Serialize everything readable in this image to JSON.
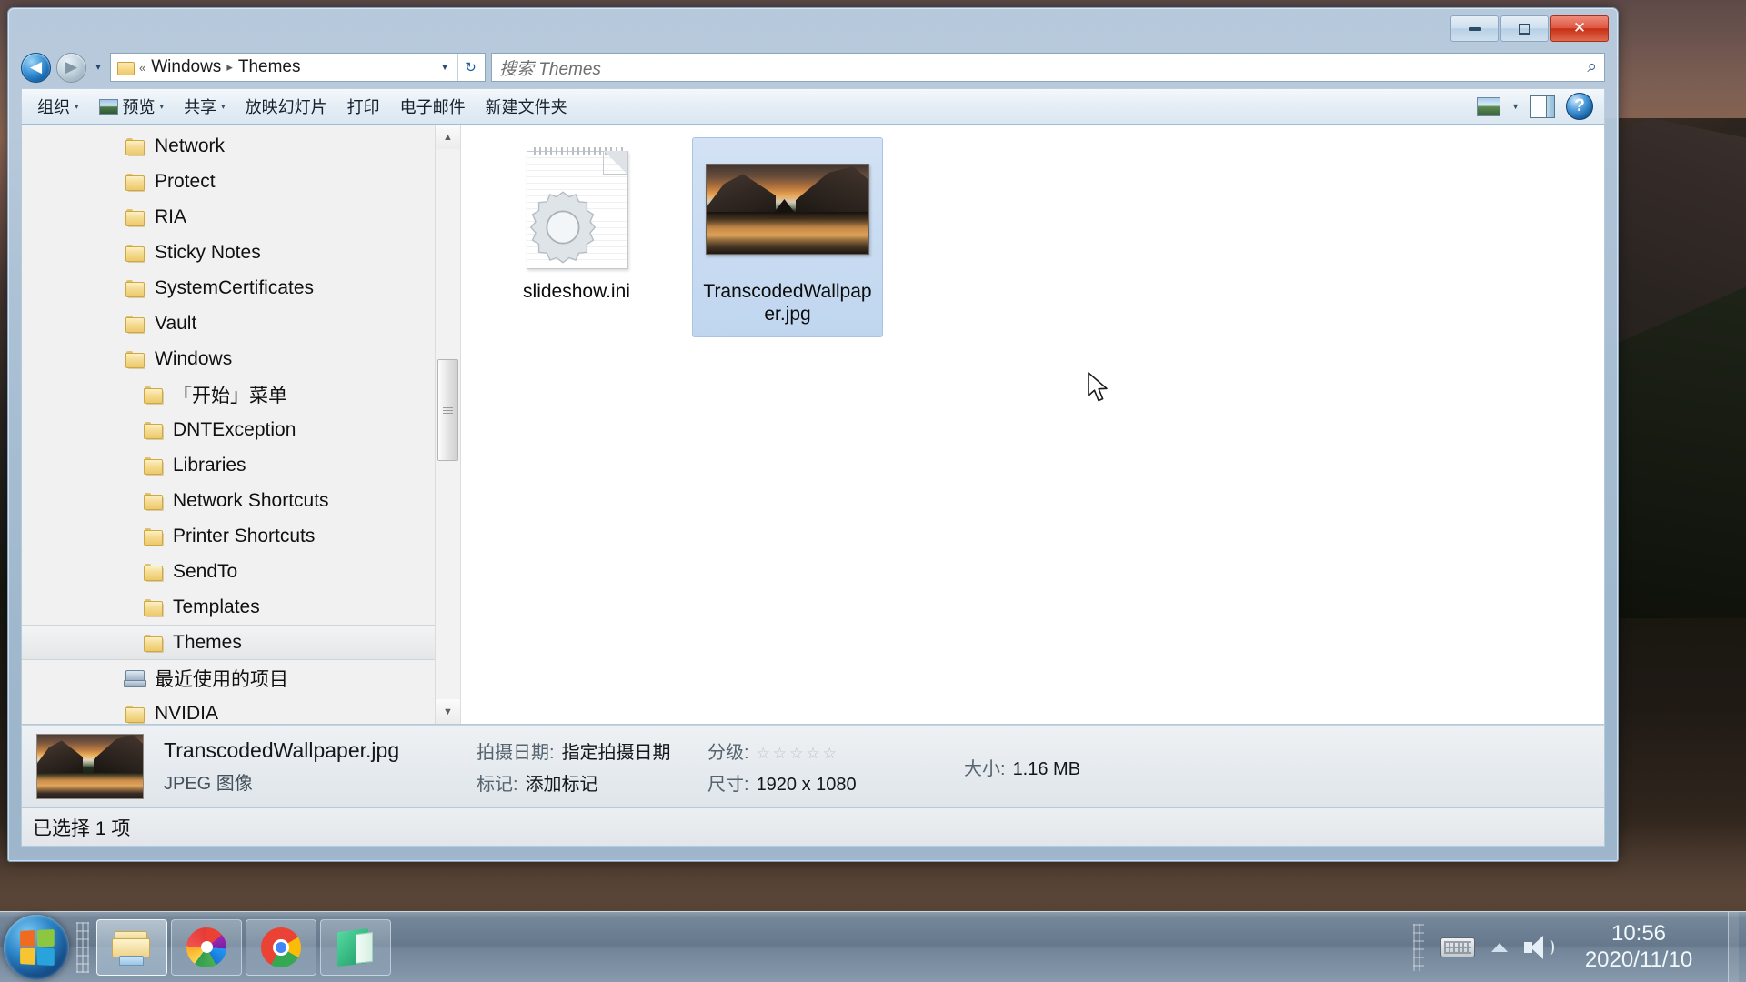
{
  "window": {
    "controls": {
      "minimize_label": "最小化",
      "maximize_label": "最大化",
      "close_label": "关闭",
      "close_glyph": "✕"
    }
  },
  "address_bar": {
    "back_label": "后退",
    "forward_label": "前进",
    "recent_dropdown_label": "最近的位置",
    "breadcrumb_prefix": "«",
    "breadcrumbs": [
      "Windows",
      "Themes"
    ],
    "separator": "▸",
    "dropdown_glyph": "▼",
    "refresh_glyph": "↻",
    "folder_icon": "folder-icon"
  },
  "search": {
    "placeholder": "搜索 Themes",
    "icon": "search-icon"
  },
  "toolbar": {
    "items": [
      {
        "label": "组织",
        "has_caret": true,
        "has_thumb": false
      },
      {
        "label": "预览",
        "has_caret": true,
        "has_thumb": true
      },
      {
        "label": "共享",
        "has_caret": true,
        "has_thumb": false
      },
      {
        "label": "放映幻灯片",
        "has_caret": false,
        "has_thumb": false
      },
      {
        "label": "打印",
        "has_caret": false,
        "has_thumb": false
      },
      {
        "label": "电子邮件",
        "has_caret": false,
        "has_thumb": false
      },
      {
        "label": "新建文件夹",
        "has_caret": false,
        "has_thumb": false
      }
    ],
    "view_button_label": "更改您的视图",
    "view_caret": "▼",
    "preview_pane_label": "显示预览窗格",
    "help_label": "获取帮助",
    "help_glyph": "?"
  },
  "tree": {
    "items": [
      {
        "label": "Network",
        "icon": "folder-icon",
        "indent": false,
        "selected": false
      },
      {
        "label": "Protect",
        "icon": "folder-icon",
        "indent": false,
        "selected": false
      },
      {
        "label": "RIA",
        "icon": "folder-icon",
        "indent": false,
        "selected": false
      },
      {
        "label": "Sticky Notes",
        "icon": "folder-icon",
        "indent": false,
        "selected": false
      },
      {
        "label": "SystemCertificates",
        "icon": "folder-icon",
        "indent": false,
        "selected": false
      },
      {
        "label": "Vault",
        "icon": "folder-icon",
        "indent": false,
        "selected": false
      },
      {
        "label": "Windows",
        "icon": "folder-icon",
        "indent": false,
        "selected": false
      },
      {
        "label": "「开始」菜单",
        "icon": "folder-icon",
        "indent": true,
        "selected": false
      },
      {
        "label": "DNTException",
        "icon": "folder-icon",
        "indent": true,
        "selected": false
      },
      {
        "label": "Libraries",
        "icon": "folder-icon",
        "indent": true,
        "selected": false
      },
      {
        "label": "Network Shortcuts",
        "icon": "folder-icon",
        "indent": true,
        "selected": false
      },
      {
        "label": "Printer Shortcuts",
        "icon": "folder-icon",
        "indent": true,
        "selected": false
      },
      {
        "label": "SendTo",
        "icon": "folder-icon",
        "indent": true,
        "selected": false
      },
      {
        "label": "Templates",
        "icon": "folder-icon",
        "indent": true,
        "selected": false
      },
      {
        "label": "Themes",
        "icon": "folder-icon",
        "indent": true,
        "selected": true
      },
      {
        "label": "最近使用的项目",
        "icon": "recent-items-icon",
        "indent": false,
        "selected": false
      },
      {
        "label": "NVIDIA",
        "icon": "folder-icon",
        "indent": false,
        "selected": false
      }
    ],
    "scroll_up_glyph": "▲",
    "scroll_down_glyph": "▼"
  },
  "files": [
    {
      "name": "slideshow.ini",
      "icon": "ini-file-icon",
      "selected": false
    },
    {
      "name": "TranscodedWallpaper.jpg",
      "icon": "image-thumbnail",
      "selected": true
    }
  ],
  "details": {
    "file_name": "TranscodedWallpaper.jpg",
    "file_type": "JPEG 图像",
    "date_taken_key": "拍摄日期:",
    "date_taken_value": "指定拍摄日期",
    "tags_key": "标记:",
    "tags_value": "添加标记",
    "rating_key": "分级:",
    "rating_stars": 0,
    "rating_max": 5,
    "dimensions_key": "尺寸:",
    "dimensions_value": "1920 x 1080",
    "size_key": "大小:",
    "size_value": "1.16 MB"
  },
  "status_bar": {
    "text": "已选择 1 项"
  },
  "taskbar": {
    "start_label": "开始",
    "tasks": [
      {
        "icon": "windows-explorer-icon",
        "label": "Windows 资源管理器",
        "active": true
      },
      {
        "icon": "chromium-icon",
        "label": "Chromium",
        "active": false
      },
      {
        "icon": "google-chrome-icon",
        "label": "Google Chrome",
        "active": false
      },
      {
        "icon": "notebook-icon",
        "label": "笔记本",
        "active": false
      }
    ],
    "tray": {
      "keyboard_label": "输入法",
      "show_hidden_label": "显示隐藏的图标",
      "show_hidden_glyph": "▲",
      "volume_label": "音量",
      "time": "10:56",
      "date": "2020/11/10",
      "show_desktop_label": "显示桌面"
    }
  },
  "colors": {
    "accent": "#1766ad",
    "selection": "#c0d6ef",
    "close_button": "#c62e13",
    "title_bar": "#a8c4de"
  }
}
